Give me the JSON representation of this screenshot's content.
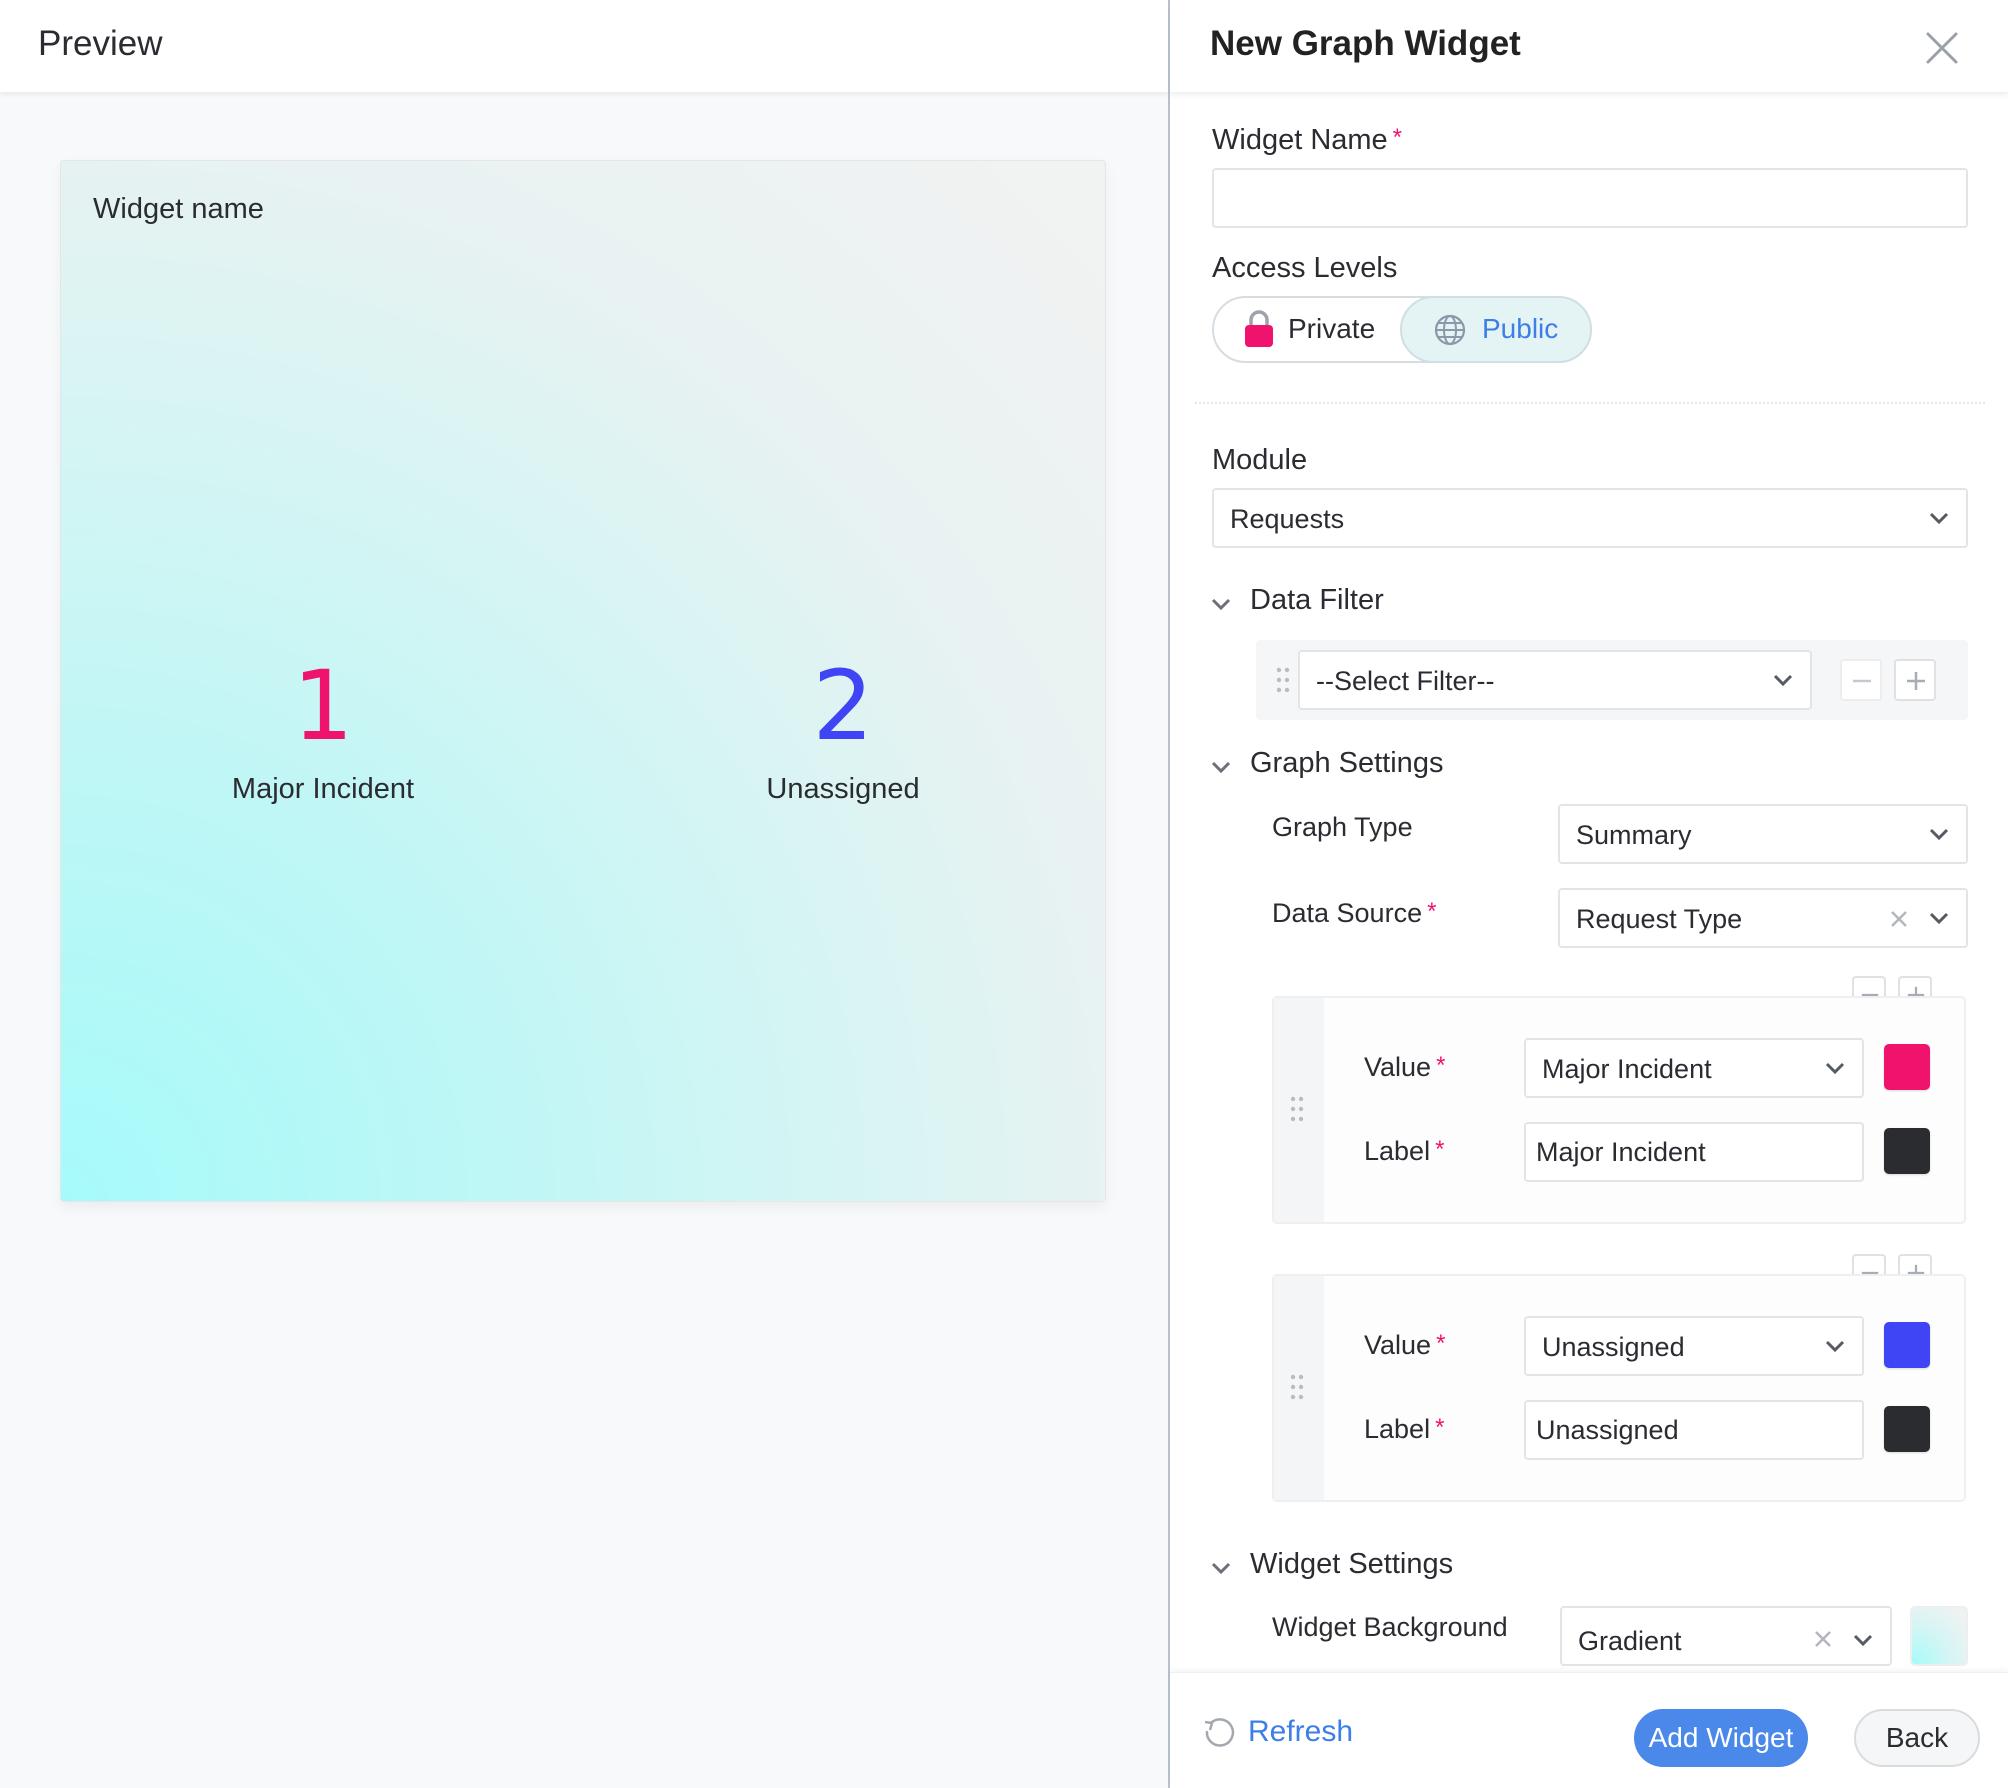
{
  "preview": {
    "title": "Preview",
    "widget": {
      "name_placeholder": "Widget name",
      "stats": [
        {
          "value": "1",
          "label": "Major Incident",
          "color": "#f0136e"
        },
        {
          "value": "2",
          "label": "Unassigned",
          "color": "#3f44f4"
        }
      ],
      "background": "Gradient"
    }
  },
  "panel": {
    "title": "New Graph Widget",
    "close_icon": "close-icon",
    "widget_name": {
      "label": "Widget Name",
      "required": "*",
      "value": "",
      "placeholder": ""
    },
    "access_levels": {
      "label": "Access Levels",
      "options": [
        {
          "label": "Private",
          "icon": "lock-icon",
          "selected": false
        },
        {
          "label": "Public",
          "icon": "globe-icon",
          "selected": true
        }
      ]
    },
    "module": {
      "label": "Module",
      "value": "Requests"
    },
    "data_filter": {
      "title": "Data Filter",
      "filter_value": "--Select Filter--"
    },
    "graph_settings": {
      "title": "Graph Settings",
      "graph_type": {
        "label": "Graph Type",
        "value": "Summary"
      },
      "data_source": {
        "label": "Data Source",
        "required": "*",
        "value": "Request Type"
      },
      "entries": [
        {
          "value_label": "Value",
          "value": "Major Incident",
          "value_color": "#f0136e",
          "label_label": "Label",
          "label": "Major Incident",
          "label_color": "#2b2c30"
        },
        {
          "value_label": "Value",
          "value": "Unassigned",
          "value_color": "#3f44f4",
          "label_label": "Label",
          "label": "Unassigned",
          "label_color": "#2b2c30"
        }
      ]
    },
    "widget_settings": {
      "title": "Widget Settings",
      "background": {
        "label": "Widget Background",
        "value": "Gradient"
      }
    },
    "footer": {
      "refresh_label": "Refresh",
      "add_label": "Add Widget",
      "back_label": "Back"
    },
    "colors": {
      "accent": "#4a89ea",
      "required": "#f0136e"
    }
  }
}
